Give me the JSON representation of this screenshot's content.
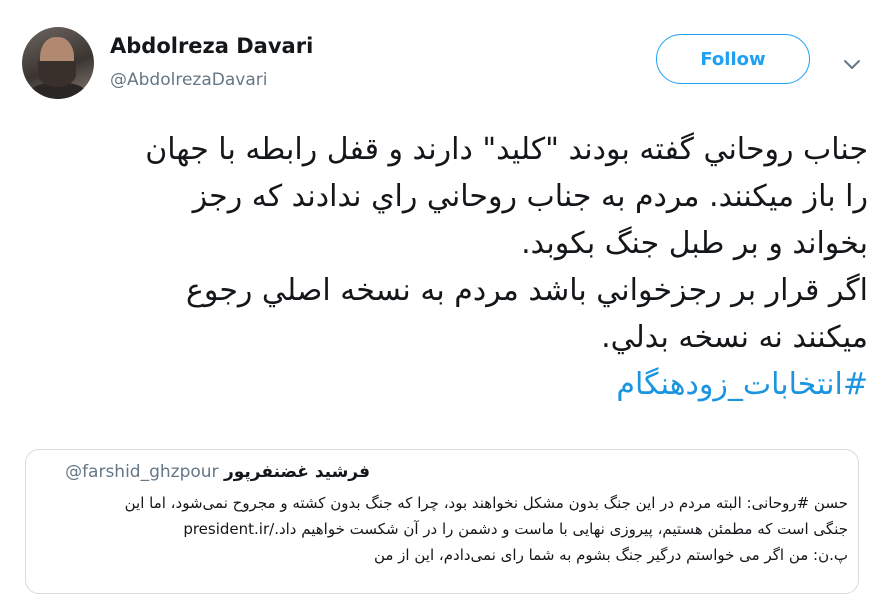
{
  "author": {
    "name": "Abdolreza Davari",
    "handle": "@AbdolrezaDavari"
  },
  "follow_button": {
    "label": "Follow"
  },
  "icons": {
    "menu": "chevron-down-icon",
    "avatar": "profile-photo"
  },
  "tweet": {
    "lines": [
      "جناب روحاني گفته بودند \"كليد\" دارند و قفل رابطه با جهان",
      "را باز ميكنند. مردم به جناب روحاني راي ندادند كه رجز",
      "بخواند و بر طبل جنگ بكوبد.",
      "اگر قرار بر رجزخواني باشد مردم به نسخه اصلي رجوع",
      "ميكنند نه نسخه بدلي."
    ],
    "hashtag": "#انتخابات_زودهنگام"
  },
  "quoted_tweet": {
    "name": "فرشید غضنفرپور",
    "handle": "@farshid_ghzpour",
    "lines": [
      "حسن #روحانی: البته مردم در این جنگ بدون مشکل نخواهند بود، چرا که جنگ بدون کشته و مجروح نمی‌شود، اما این",
      "جنگی است که مطمئن هستیم، پیروزی نهایی با ماست و دشمن را در آن شکست خواهیم داد./president.ir",
      "پ.ن: من اگر می خواستم درگیر جنگ بشوم به شما رای نمی‌دادم، این از من"
    ]
  },
  "colors": {
    "accent": "#1da1f2",
    "hashtag": "#1b95e0",
    "secondary_text": "#657786",
    "border": "#d3dce3"
  }
}
